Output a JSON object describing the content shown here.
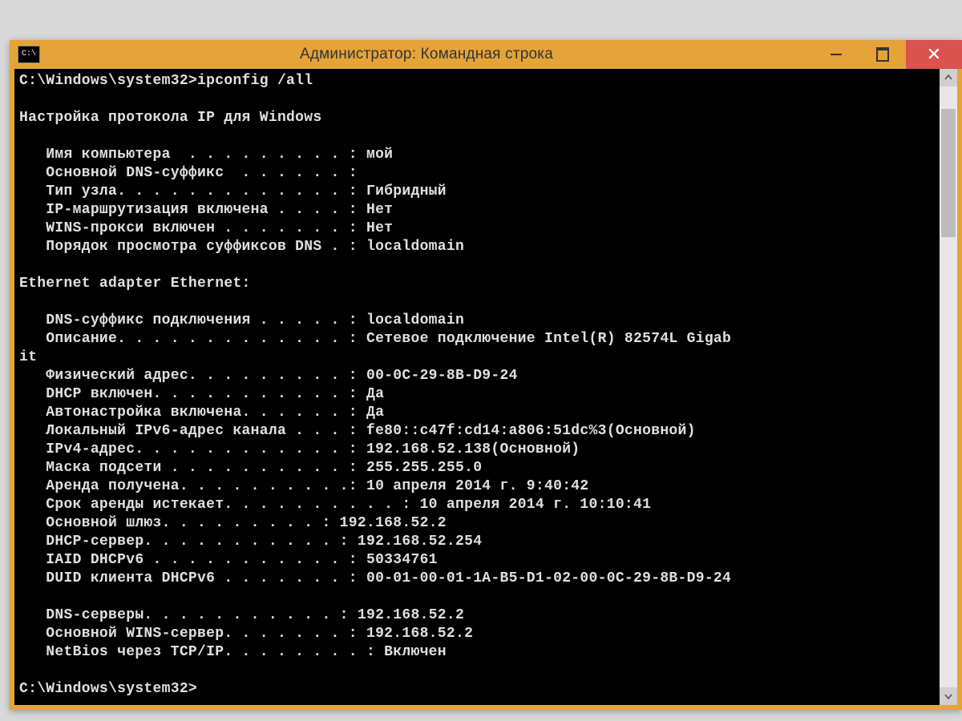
{
  "window": {
    "title": "Администратор: Командная строка"
  },
  "console_text": "C:\\Windows\\system32>ipconfig /all\n\nНастройка протокола IP для Windows\n\n   Имя компьютера  . . . . . . . . . : мой\n   Основной DNS-суффикс  . . . . . . :\n   Тип узла. . . . . . . . . . . . . : Гибридный\n   IP-маршрутизация включена . . . . : Нет\n   WINS-прокси включен . . . . . . . : Нет\n   Порядок просмотра суффиксов DNS . : localdomain\n\nEthernet adapter Ethernet:\n\n   DNS-суффикс подключения . . . . . : localdomain\n   Описание. . . . . . . . . . . . . : Сетевое подключение Intel(R) 82574L Gigab\nit\n   Физический адрес. . . . . . . . . : 00-0C-29-8B-D9-24\n   DHCP включен. . . . . . . . . . . : Да\n   Автонастройка включена. . . . . . : Да\n   Локальный IPv6-адрес канала . . . : fe80::c47f:cd14:a806:51dc%3(Основной)\n   IPv4-адрес. . . . . . . . . . . . : 192.168.52.138(Основной)\n   Маска подсети . . . . . . . . . . : 255.255.255.0\n   Аренда получена. . . . . . . . . .: 10 апреля 2014 г. 9:40:42\n   Срок аренды истекает. . . . . . . . . . : 10 апреля 2014 г. 10:10:41\n   Основной шлюз. . . . . . . . . : 192.168.52.2\n   DHCP-сервер. . . . . . . . . . . : 192.168.52.254\n   IAID DHCPv6 . . . . . . . . . . . : 50334761\n   DUID клиента DHCPv6 . . . . . . . : 00-01-00-01-1A-B5-D1-02-00-0C-29-8B-D9-24\n\n   DNS-серверы. . . . . . . . . . . : 192.168.52.2\n   Основной WINS-сервер. . . . . . . : 192.168.52.2\n   NetBios через TCP/IP. . . . . . . . : Включен\n\nC:\\Windows\\system32>"
}
